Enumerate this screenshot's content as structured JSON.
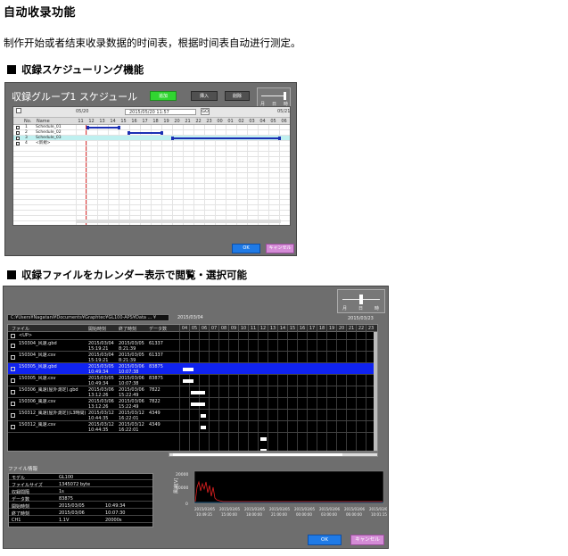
{
  "page": {
    "title": "自动收录功能",
    "description": "制作开始或者结束收录数据的时间表，根据时间表自动进行测定。",
    "section1_title": "収録スケジューリング機能",
    "section2_title": "収録ファイルをカレンダー表示で閲覧・選択可能"
  },
  "schedule": {
    "title": "収録グループ1 スケジュール",
    "btn_new": "追加",
    "btn_insert": "挿入",
    "btn_delete": "削除",
    "zoom_labels": [
      "月",
      "日",
      "時"
    ],
    "date_left": "05/20",
    "date_center": "2015/05/20 11:57",
    "date_btn": "GO",
    "date_right": "05/21",
    "col_no": "No.",
    "col_name": "Name",
    "hours": [
      "11",
      "12",
      "13",
      "14",
      "15",
      "16",
      "17",
      "18",
      "19",
      "20",
      "21",
      "22",
      "23",
      "00",
      "01",
      "02",
      "03",
      "04",
      "05",
      "06"
    ],
    "rows": [
      {
        "no": "1",
        "name": "Schedule_01"
      },
      {
        "no": "2",
        "name": "Schedule_02"
      },
      {
        "no": "3",
        "name": "Schedule_03"
      },
      {
        "no": "4",
        "name": "<新規>"
      }
    ],
    "ok": "OK",
    "cancel": "キャンセル"
  },
  "files": {
    "zoom_labels": [
      "月",
      "日",
      "時"
    ],
    "path": "C:¥Users¥Nagatani¥Documents¥Graphtec¥GL100-APS¥Data ... ¥",
    "date_left": "2015/03/04",
    "date_right": "2015/03/23",
    "col_file": "ファイル",
    "col_start": "開始時刻",
    "col_end": "終了時刻",
    "col_count": "データ数",
    "hours": [
      "04",
      "05",
      "06",
      "07",
      "08",
      "09",
      "10",
      "11",
      "12",
      "13",
      "14",
      "15",
      "16",
      "17",
      "18",
      "19",
      "20",
      "21",
      "22",
      "23"
    ],
    "rows": [
      {
        "name": "<UP>",
        "start": "",
        "start2": "",
        "end": "",
        "end2": "",
        "count": ""
      },
      {
        "name": "150304_风速.gbd",
        "start": "2015/03/04",
        "start2": "15:19:21",
        "end": "2015/03/05",
        "end2": "8:21:39",
        "count": "61337"
      },
      {
        "name": "150304_风速.csv",
        "start": "2015/03/04",
        "start2": "15:19:21",
        "end": "2015/03/05",
        "end2": "8:21:39",
        "count": "61337"
      },
      {
        "name": "150305_风速.gbd",
        "start": "2015/03/05",
        "start2": "10:49:34",
        "end": "2015/03/06",
        "end2": "10:07:38",
        "count": "83875"
      },
      {
        "name": "150305_风速.csv",
        "start": "2015/03/05",
        "start2": "10:49:34",
        "end": "2015/03/06",
        "end2": "10:07:38",
        "count": "83875"
      },
      {
        "name": "150306_風速(屋外測定).gbd",
        "start": "2015/03/06",
        "start2": "13:12:26",
        "end": "2015/03/06",
        "end2": "15:22:49",
        "count": "7822"
      },
      {
        "name": "150306_風速.csv",
        "start": "2015/03/06",
        "start2": "13:12:26",
        "end": "2015/03/06",
        "end2": "15:22:49",
        "count": "7822"
      },
      {
        "name": "150312_風速(屋外測定)(L3時間)",
        "start": "2015/03/12",
        "start2": "10:44:35",
        "end": "2015/03/12",
        "end2": "16:22:01",
        "count": "4349"
      },
      {
        "name": "150312_風速.csv",
        "start": "2015/03/12",
        "start2": "10:44:35",
        "end": "2015/03/12",
        "end2": "16:22:01",
        "count": "4349"
      }
    ],
    "info_title": "ファイル情報",
    "info": [
      {
        "k": "モデル",
        "v": "GL100",
        "v2": ""
      },
      {
        "k": "ファイルサイズ",
        "v": "1345072 byte",
        "v2": ""
      },
      {
        "k": "収録間隔",
        "v": "1s",
        "v2": ""
      },
      {
        "k": "データ数",
        "v": "83875",
        "v2": ""
      },
      {
        "k": "開始時刻",
        "v": "2015/03/05",
        "v2": "10:49:34"
      },
      {
        "k": "終了時刻",
        "v": "2015/03/06",
        "v2": "10:07:30"
      },
      {
        "k": "CH1",
        "v": "1.1V",
        "v2": "20000s"
      }
    ],
    "graph_ylabel": "風速[V]",
    "graph_ymax": "20000",
    "graph_ymid": "10000",
    "graph_ymin": "0",
    "graph_xdates": [
      "2015/03/05",
      "2015/03/05",
      "2015/03/05",
      "2015/03/05",
      "2015/03/05",
      "2015/03/06",
      "2015/03/06",
      "2015/03/06"
    ],
    "graph_xtimes": [
      "10:49:35",
      "15:00:00",
      "18:00:00",
      "21:00:00",
      "00:00:00",
      "03:00:00",
      "06:00:00",
      "10:01:15"
    ],
    "ok": "OK",
    "cancel": "キャンセル"
  },
  "colors": {
    "accent_green": "#31d531",
    "ok_blue": "#1f7ae6",
    "cancel_pink": "#d48bd6",
    "selected_row": "#1023ef",
    "schedule_bar": "#1b2fb4",
    "now_line": "#e63a3a"
  }
}
